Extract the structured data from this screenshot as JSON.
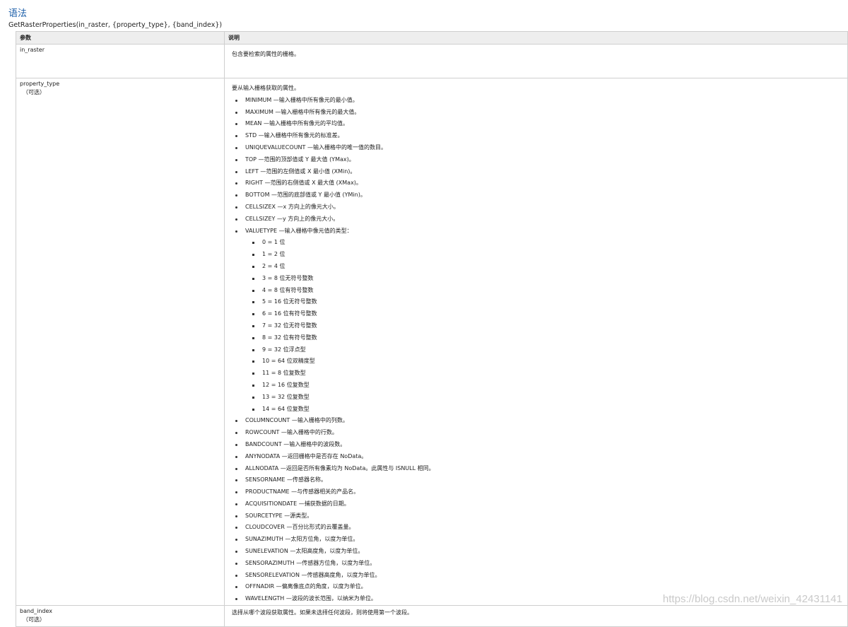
{
  "heading": "语法",
  "syntax": "GetRasterProperties(in_raster, {property_type}, {band_index})",
  "table": {
    "headers": [
      "参数",
      "说明"
    ],
    "in_raster": {
      "name": "in_raster",
      "desc": "包含要检索的属性的栅格。"
    },
    "property_type": {
      "name": "property_type",
      "optional": "（可选）",
      "intro": "要从输入栅格获取的属性。",
      "items": [
        "MINIMUM —输入栅格中所有像元的最小值。",
        "MAXIMUM —输入栅格中所有像元的最大值。",
        "MEAN —输入栅格中所有像元的平均值。",
        "STD —输入栅格中所有像元的标准差。",
        "UNIQUEVALUECOUNT —输入栅格中的唯一值的数目。",
        "TOP —范围的顶部值或 Y 最大值 (YMax)。",
        "LEFT —范围的左侧值或 X 最小值 (XMin)。",
        "RIGHT —范围的右侧值或 X 最大值 (XMax)。",
        "BOTTOM —范围的底部值或 Y 最小值 (YMin)。",
        "CELLSIZEX —x 方向上的像元大小。",
        "CELLSIZEY —y 方向上的像元大小。",
        "VALUETYPE —输入栅格中像元值的类型："
      ],
      "value_types": [
        "0 = 1 位",
        "1 = 2 位",
        "2 = 4 位",
        "3 = 8 位无符号整数",
        "4 = 8 位有符号整数",
        "5 = 16 位无符号整数",
        "6 = 16 位有符号整数",
        "7 = 32 位无符号整数",
        "8 = 32 位有符号整数",
        "9 = 32 位浮点型",
        "10 = 64 位双精度型",
        "11 = 8 位复数型",
        "12 = 16 位复数型",
        "13 = 32 位复数型",
        "14 = 64 位复数型"
      ],
      "items_after": [
        "COLUMNCOUNT —输入栅格中的列数。",
        "ROWCOUNT —输入栅格中的行数。",
        "BANDCOUNT —输入栅格中的波段数。",
        "ANYNODATA —返回栅格中是否存在 NoData。",
        "ALLNODATA —返回是否所有像素均为 NoData。此属性与 ISNULL 相同。",
        "SENSORNAME —传感器名称。",
        "PRODUCTNAME —与传感器相关的产品名。",
        "ACQUISITIONDATE —捕获数据的日期。",
        "SOURCETYPE —源类型。",
        "CLOUDCOVER —百分比形式的云覆盖量。",
        "SUNAZIMUTH —太阳方位角，以度为单位。",
        "SUNELEVATION —太阳高度角，以度为单位。",
        "SENSORAZIMUTH —传感器方位角，以度为单位。",
        "SENSORELEVATION —传感器高度角，以度为单位。",
        "OFFNADIR —偏离像底点的角度，以度为单位。",
        "WAVELENGTH —波段的波长范围，以纳米为单位。"
      ]
    },
    "band_index": {
      "name": "band_index",
      "optional": "（可选）",
      "desc": "选择从哪个波段获取属性。如果未选择任何波段，则将使用第一个波段。"
    }
  },
  "watermark": "https://blog.csdn.net/weixin_42431141"
}
